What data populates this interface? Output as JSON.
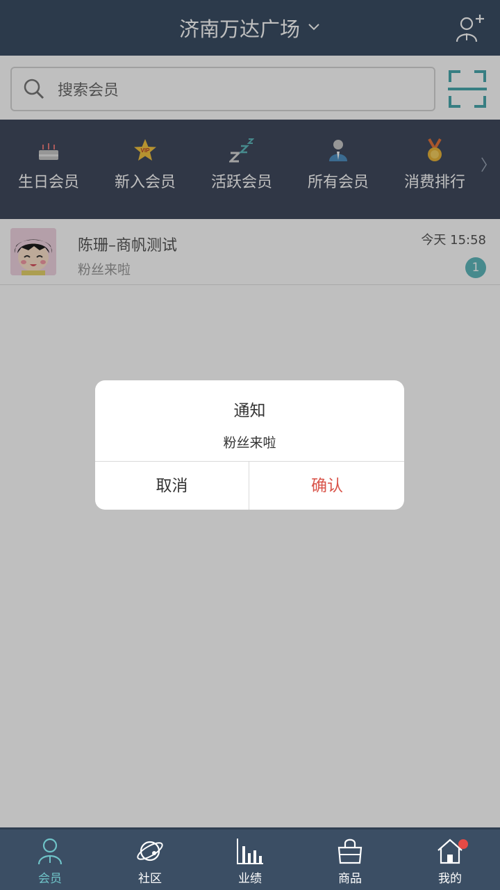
{
  "header": {
    "title": "济南万达广场"
  },
  "search": {
    "placeholder": "搜索会员"
  },
  "categories": [
    {
      "label": "生日会员",
      "icon": "birthday-cake-icon"
    },
    {
      "label": "新入会员",
      "icon": "vip-star-icon"
    },
    {
      "label": "活跃会员",
      "icon": "zzz-icon"
    },
    {
      "label": "所有会员",
      "icon": "person-icon"
    },
    {
      "label": "消费排行",
      "icon": "medal-icon"
    }
  ],
  "list": [
    {
      "name": "陈珊–商帆测试",
      "message": "粉丝来啦",
      "time": "今天 15:58",
      "badge": "1"
    }
  ],
  "dialog": {
    "title": "通知",
    "message": "粉丝来啦",
    "cancel": "取消",
    "confirm": "确认"
  },
  "tabs": [
    {
      "label": "会员",
      "active": true
    },
    {
      "label": "社区"
    },
    {
      "label": "业绩"
    },
    {
      "label": "商品"
    },
    {
      "label": "我的"
    }
  ],
  "colors": {
    "header": "#3b4e64",
    "accent": "#5fb8bd",
    "confirm": "#d9544a"
  }
}
